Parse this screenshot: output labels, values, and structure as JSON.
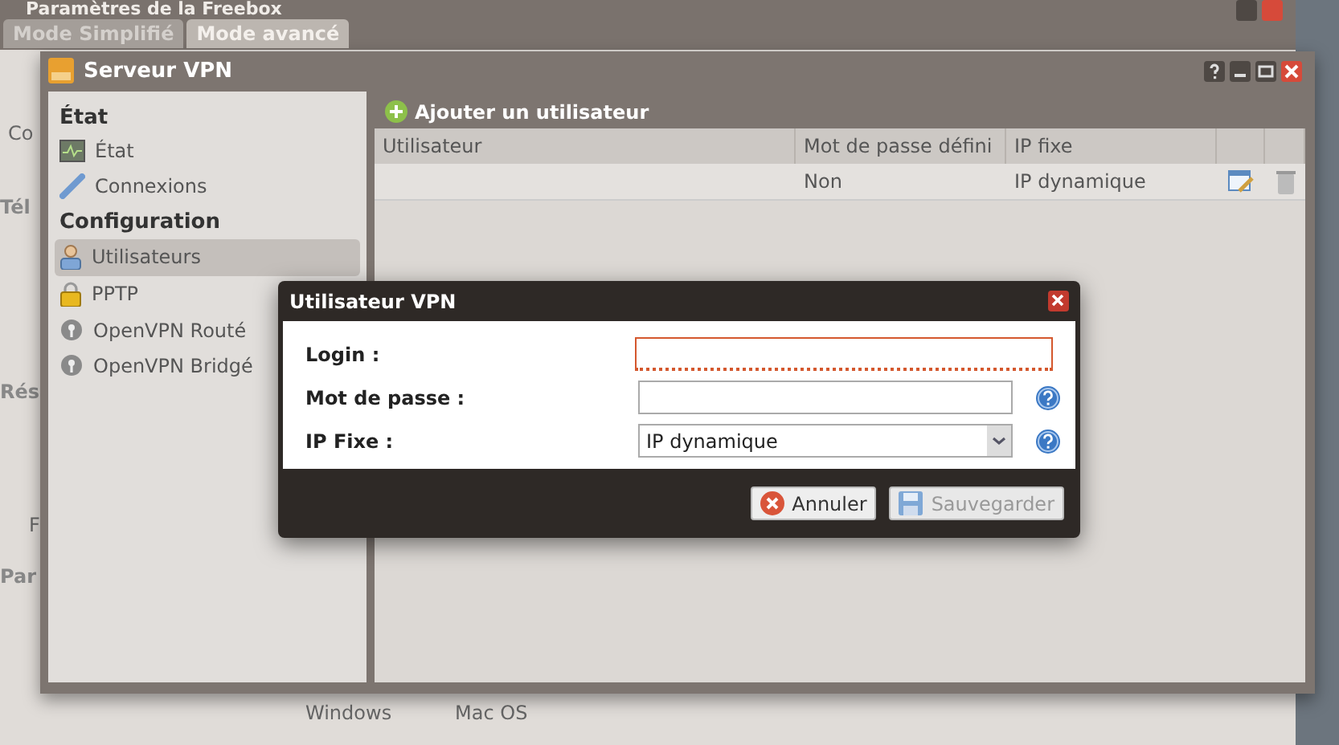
{
  "background_window": {
    "title": "Paramètres de la Freebox",
    "tabs": [
      {
        "label": "Mode Simplifié",
        "selected": false
      },
      {
        "label": "Mode avancé",
        "selected": true
      }
    ],
    "side_fragments": [
      {
        "text": "Co",
        "kind": "item"
      },
      {
        "text": "Tél",
        "kind": "heading"
      },
      {
        "text": "Rés",
        "kind": "heading"
      },
      {
        "text": "F",
        "kind": "item"
      },
      {
        "text": "Par",
        "kind": "heading"
      }
    ],
    "bottom_labels": [
      "Windows",
      "Mac OS"
    ]
  },
  "window": {
    "title": "Serveur VPN",
    "sidebar": [
      {
        "heading": "État",
        "items": [
          {
            "label": "État",
            "kind": "status",
            "selected": false
          },
          {
            "label": "Connexions",
            "kind": "connections",
            "selected": false
          }
        ]
      },
      {
        "heading": "Configuration",
        "items": [
          {
            "label": "Utilisateurs",
            "kind": "users",
            "selected": true
          },
          {
            "label": "PPTP",
            "kind": "pptp",
            "selected": false
          },
          {
            "label": "OpenVPN Routé",
            "kind": "openvpn",
            "selected": false
          },
          {
            "label": "OpenVPN Bridgé",
            "kind": "openvpn",
            "selected": false
          }
        ]
      }
    ],
    "add_button": "Ajouter un utilisateur",
    "table": {
      "columns": [
        "Utilisateur",
        "Mot de passe défini",
        "IP fixe"
      ],
      "rows": [
        {
          "password_set": "Non",
          "ip": "IP dynamique"
        }
      ]
    }
  },
  "dialog": {
    "title": "Utilisateur VPN",
    "fields": [
      {
        "label": "Login :",
        "kind": "text",
        "invalid": true,
        "help": false
      },
      {
        "label": "Mot de passe :",
        "kind": "password",
        "invalid": false,
        "help": true
      },
      {
        "label": "IP Fixe :",
        "kind": "select",
        "value": "IP dynamique",
        "invalid": false,
        "help": true
      }
    ],
    "buttons": [
      {
        "label": "Annuler",
        "kind": "cancel",
        "disabled": false
      },
      {
        "label": "Sauvegarder",
        "kind": "save",
        "disabled": true
      }
    ]
  }
}
